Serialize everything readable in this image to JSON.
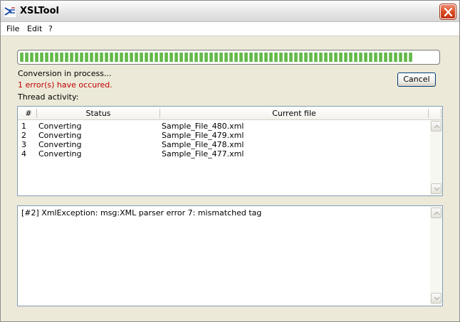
{
  "window": {
    "title": "XSLTool",
    "icon": "xsltool-app-icon",
    "close_icon": "close-icon"
  },
  "menu": {
    "items": [
      "File",
      "Edit",
      "?"
    ]
  },
  "progress": {
    "fraction": 0.94
  },
  "status": {
    "conversion": "Conversion in process...",
    "errors": "1 error(s) have occured.",
    "thread_activity_label": "Thread activity:",
    "error_color": "#c00000"
  },
  "buttons": {
    "cancel": "Cancel"
  },
  "thread_table": {
    "columns": [
      "#",
      "Status",
      "Current file"
    ],
    "rows": [
      {
        "num": "1",
        "status": "Converting",
        "file": "Sample_File_480.xml"
      },
      {
        "num": "2",
        "status": "Converting",
        "file": "Sample_File_479.xml"
      },
      {
        "num": "3",
        "status": "Converting",
        "file": "Sample_File_478.xml"
      },
      {
        "num": "4",
        "status": "Converting",
        "file": "Sample_File_477.xml"
      }
    ]
  },
  "log": {
    "lines": [
      "[#2] XmlException: msg:XML parser error 7: mismatched tag"
    ]
  }
}
